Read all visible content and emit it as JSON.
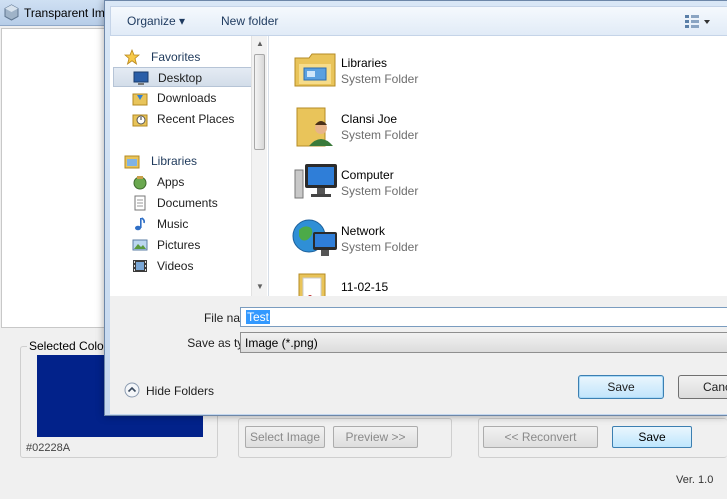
{
  "app": {
    "title": "Transparent Im",
    "selected_color_label": "Selected Color",
    "selected_color_hex": "#02228A",
    "select_image_label": "Select Image",
    "preview_label": "Preview >>",
    "reconvert_label": "<< Reconvert",
    "save_label": "Save",
    "version": "Ver. 1.0"
  },
  "dialog": {
    "toolbar": {
      "organize_label": "Organize ▾",
      "new_folder_label": "New folder",
      "views_icon": "views-icon"
    },
    "nav": {
      "items": [
        {
          "label": "Favorites",
          "icon": "star-icon",
          "header": true
        },
        {
          "label": "Desktop",
          "icon": "desktop-icon",
          "selected": true
        },
        {
          "label": "Downloads",
          "icon": "downloads-icon"
        },
        {
          "label": "Recent Places",
          "icon": "recent-places-icon"
        },
        {
          "label": "Libraries",
          "icon": "libraries-icon",
          "header": true
        },
        {
          "label": "Apps",
          "icon": "apps-icon"
        },
        {
          "label": "Documents",
          "icon": "documents-icon"
        },
        {
          "label": "Music",
          "icon": "music-icon"
        },
        {
          "label": "Pictures",
          "icon": "pictures-icon"
        },
        {
          "label": "Videos",
          "icon": "videos-icon"
        }
      ]
    },
    "files": [
      {
        "name": "Libraries",
        "type": "System Folder",
        "icon": "libraries-folder-icon"
      },
      {
        "name": "Clansi Joe",
        "type": "System Folder",
        "icon": "user-folder-icon"
      },
      {
        "name": "Computer",
        "type": "System Folder",
        "icon": "computer-icon"
      },
      {
        "name": "Network",
        "type": "System Folder",
        "icon": "network-icon"
      },
      {
        "name": "11-02-15",
        "type": "",
        "icon": "folder-icon"
      }
    ],
    "file_name_label": "File name:",
    "file_name_value": "Test",
    "save_as_type_label": "Save as type:",
    "save_as_type_value": "Image (*.png)",
    "hide_folders_label": "Hide Folders",
    "save_label": "Save",
    "cancel_label": "Cancel"
  },
  "colors": {
    "selected_color": "#02228A",
    "selection_highlight": "#3399ff"
  }
}
